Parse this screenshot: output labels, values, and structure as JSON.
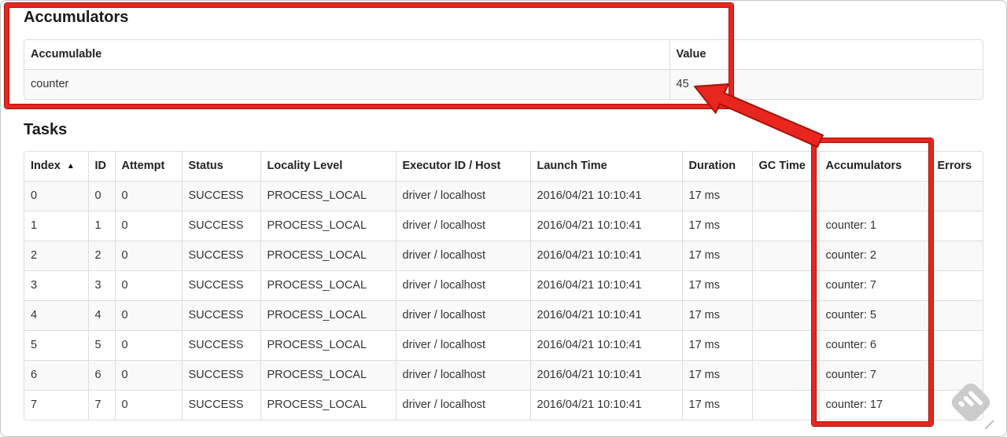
{
  "accumulators_section": {
    "heading": "Accumulators",
    "table": {
      "headers": [
        "Accumulable",
        "Value"
      ],
      "rows": [
        [
          "counter",
          "45"
        ]
      ]
    }
  },
  "tasks_section": {
    "heading": "Tasks",
    "sort_icon": "▲",
    "table": {
      "headers": [
        "Index",
        "ID",
        "Attempt",
        "Status",
        "Locality Level",
        "Executor ID / Host",
        "Launch Time",
        "Duration",
        "GC Time",
        "Accumulators",
        "Errors"
      ],
      "rows": [
        [
          "0",
          "0",
          "0",
          "SUCCESS",
          "PROCESS_LOCAL",
          "driver / localhost",
          "2016/04/21 10:10:41",
          "17 ms",
          "",
          "",
          ""
        ],
        [
          "1",
          "1",
          "0",
          "SUCCESS",
          "PROCESS_LOCAL",
          "driver / localhost",
          "2016/04/21 10:10:41",
          "17 ms",
          "",
          "counter: 1",
          ""
        ],
        [
          "2",
          "2",
          "0",
          "SUCCESS",
          "PROCESS_LOCAL",
          "driver / localhost",
          "2016/04/21 10:10:41",
          "17 ms",
          "",
          "counter: 2",
          ""
        ],
        [
          "3",
          "3",
          "0",
          "SUCCESS",
          "PROCESS_LOCAL",
          "driver / localhost",
          "2016/04/21 10:10:41",
          "17 ms",
          "",
          "counter: 7",
          ""
        ],
        [
          "4",
          "4",
          "0",
          "SUCCESS",
          "PROCESS_LOCAL",
          "driver / localhost",
          "2016/04/21 10:10:41",
          "17 ms",
          "",
          "counter: 5",
          ""
        ],
        [
          "5",
          "5",
          "0",
          "SUCCESS",
          "PROCESS_LOCAL",
          "driver / localhost",
          "2016/04/21 10:10:41",
          "17 ms",
          "",
          "counter: 6",
          ""
        ],
        [
          "6",
          "6",
          "0",
          "SUCCESS",
          "PROCESS_LOCAL",
          "driver / localhost",
          "2016/04/21 10:10:41",
          "17 ms",
          "",
          "counter: 7",
          ""
        ],
        [
          "7",
          "7",
          "0",
          "SUCCESS",
          "PROCESS_LOCAL",
          "driver / localhost",
          "2016/04/21 10:10:41",
          "17 ms",
          "",
          "counter: 17",
          ""
        ]
      ]
    }
  },
  "annotations": {
    "accent_color": "#e8251f"
  }
}
